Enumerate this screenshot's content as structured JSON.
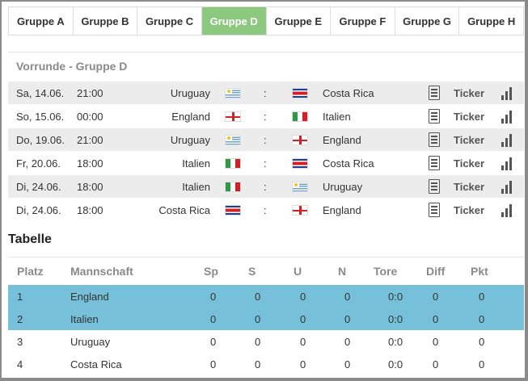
{
  "tabs": [
    {
      "label": "Gruppe A",
      "active": false
    },
    {
      "label": "Gruppe B",
      "active": false
    },
    {
      "label": "Gruppe C",
      "active": false
    },
    {
      "label": "Gruppe D",
      "active": true
    },
    {
      "label": "Gruppe E",
      "active": false
    },
    {
      "label": "Gruppe F",
      "active": false
    },
    {
      "label": "Gruppe G",
      "active": false
    },
    {
      "label": "Gruppe H",
      "active": false
    }
  ],
  "colors": {
    "active_tab": "#8cc97e",
    "highlight_row": "#76c1d9",
    "stripe": "#ececec"
  },
  "section_title": "Vorrunde - Gruppe D",
  "matches": [
    {
      "day": "Sa, 14.06.",
      "time": "21:00",
      "home": "Uruguay",
      "home_flag": "uy",
      "sep": ":",
      "away": "Costa Rica",
      "away_flag": "cr",
      "report_icon": "document-icon",
      "ticker": "Ticker",
      "stats_icon": "bar-chart-icon"
    },
    {
      "day": "So, 15.06.",
      "time": "00:00",
      "home": "England",
      "home_flag": "en",
      "sep": ":",
      "away": "Italien",
      "away_flag": "it",
      "report_icon": "document-icon",
      "ticker": "Ticker",
      "stats_icon": "bar-chart-icon"
    },
    {
      "day": "Do, 19.06.",
      "time": "21:00",
      "home": "Uruguay",
      "home_flag": "uy",
      "sep": ":",
      "away": "England",
      "away_flag": "en",
      "report_icon": "document-icon",
      "ticker": "Ticker",
      "stats_icon": "bar-chart-icon"
    },
    {
      "day": "Fr, 20.06.",
      "time": "18:00",
      "home": "Italien",
      "home_flag": "it",
      "sep": ":",
      "away": "Costa Rica",
      "away_flag": "cr",
      "report_icon": "document-icon",
      "ticker": "Ticker",
      "stats_icon": "bar-chart-icon"
    },
    {
      "day": "Di, 24.06.",
      "time": "18:00",
      "home": "Italien",
      "home_flag": "it",
      "sep": ":",
      "away": "Uruguay",
      "away_flag": "uy",
      "report_icon": "document-icon",
      "ticker": "Ticker",
      "stats_icon": "bar-chart-icon"
    },
    {
      "day": "Di, 24.06.",
      "time": "18:00",
      "home": "Costa Rica",
      "home_flag": "cr",
      "sep": ":",
      "away": "England",
      "away_flag": "en",
      "report_icon": "document-icon",
      "ticker": "Ticker",
      "stats_icon": "bar-chart-icon"
    }
  ],
  "table_title": "Tabelle",
  "standings": {
    "headers": [
      "Platz",
      "Mannschaft",
      "Sp",
      "S",
      "U",
      "N",
      "Tore",
      "Diff",
      "Pkt"
    ],
    "rows": [
      {
        "platz": "1",
        "team": "England",
        "sp": "0",
        "s": "0",
        "u": "0",
        "n": "0",
        "tore": "0:0",
        "diff": "0",
        "pkt": "0",
        "highlight": true
      },
      {
        "platz": "2",
        "team": "Italien",
        "sp": "0",
        "s": "0",
        "u": "0",
        "n": "0",
        "tore": "0:0",
        "diff": "0",
        "pkt": "0",
        "highlight": true
      },
      {
        "platz": "3",
        "team": "Uruguay",
        "sp": "0",
        "s": "0",
        "u": "0",
        "n": "0",
        "tore": "0:0",
        "diff": "0",
        "pkt": "0",
        "highlight": false
      },
      {
        "platz": "4",
        "team": "Costa Rica",
        "sp": "0",
        "s": "0",
        "u": "0",
        "n": "0",
        "tore": "0:0",
        "diff": "0",
        "pkt": "0",
        "highlight": false
      }
    ]
  }
}
